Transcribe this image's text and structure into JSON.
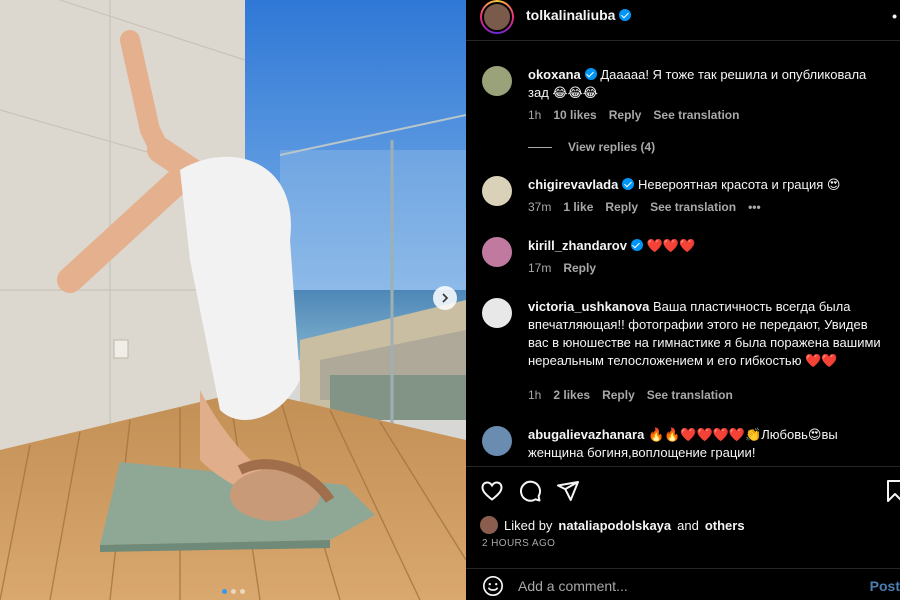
{
  "post": {
    "username": "tolkalinaliuba",
    "more": "•",
    "photo": {
      "carousel_dots": 3,
      "active_dot": 1
    }
  },
  "comments": [
    {
      "username": "okoxana",
      "verified": true,
      "text": "Дааааа! Я тоже так решила и опубликовала зад 😂😂😂",
      "time": "1h",
      "likes": "10 likes",
      "reply": "Reply",
      "translate": "See translation",
      "view_replies": "View replies (4)"
    },
    {
      "username": "chigirevavlada",
      "verified": true,
      "text": "Невероятная красота и грация 😍",
      "time": "37m",
      "likes": "1 like",
      "reply": "Reply",
      "translate": "See translation",
      "more": "•••"
    },
    {
      "username": "kirill_zhandarov",
      "verified": true,
      "text": "❤️❤️❤️",
      "time": "17m",
      "reply": "Reply"
    },
    {
      "username": "victoria_ushkanova",
      "verified": false,
      "text": "Ваша пластичность всегда была впечатляющая!! фотографии этого не передают, Увидев вас в юношестве на гимнастике я была поражена вашими нереальным телосложением и его гибкостью ❤️❤️",
      "time": "1h",
      "likes": "2 likes",
      "reply": "Reply",
      "translate": "See translation"
    },
    {
      "username": "abugalievazhanara",
      "verified": false,
      "text": "🔥🔥❤️❤️❤️❤️👏Любовь😍вы женщина богиня,воплощение грации!"
    }
  ],
  "actions": {
    "like_icon": "heart-icon",
    "comment_icon": "comment-icon",
    "share_icon": "share-icon",
    "save_icon": "bookmark-icon"
  },
  "likes_summary": {
    "prefix": "Liked by",
    "user": "nataliapodolskaya",
    "and": "and",
    "others": "others"
  },
  "posted_ago": "2 HOURS AGO",
  "add_comment": {
    "placeholder": "Add a comment...",
    "post_label": "Post"
  },
  "colors": {
    "background": "#000000",
    "verified": "#0095f6",
    "muted": "#a8a8a8",
    "post_button": "#4a7fb0"
  }
}
